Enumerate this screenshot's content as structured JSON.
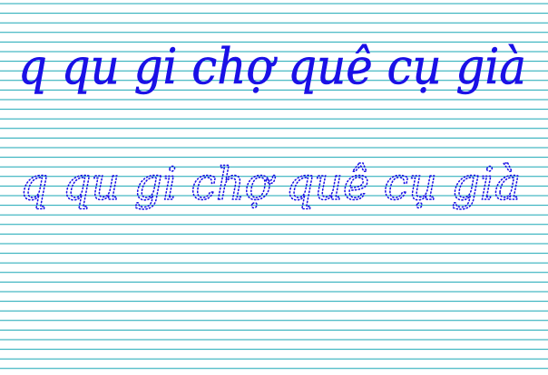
{
  "worksheet": {
    "colors": {
      "paper": "#ffffff",
      "rule_line": "#1aa7b5",
      "ink": "#1a10e6"
    },
    "model_line": {
      "style": "solid cursive",
      "text": "q qu gi chợ quê cụ già"
    },
    "trace_line": {
      "style": "dotted cursive",
      "text": "q qu gi chợ quê cụ già"
    }
  }
}
